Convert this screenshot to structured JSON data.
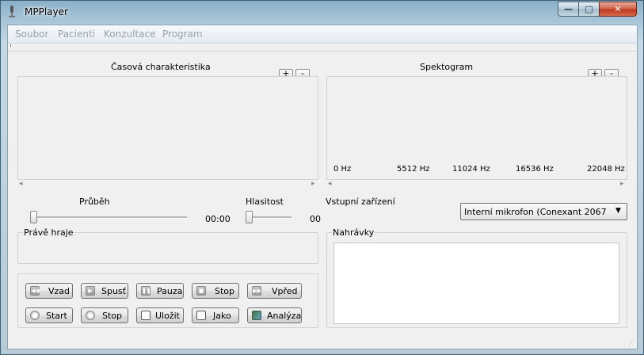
{
  "window": {
    "title": "MPPlayer",
    "minimize_glyph": "—",
    "maximize_glyph": "□",
    "close_glyph": "✕"
  },
  "menu": {
    "items": [
      "Soubor",
      "Pacienti",
      "Konzultace",
      "Program"
    ]
  },
  "time_panel": {
    "title": "Časová charakteristika",
    "zoom_in": "+",
    "zoom_out": "-"
  },
  "spectrogram": {
    "title": "Spektogram",
    "zoom_in": "+",
    "zoom_out": "-",
    "freq_labels": [
      "0 Hz",
      "5512 Hz",
      "11024 Hz",
      "16536 Hz",
      "22048 Hz"
    ]
  },
  "scroll": {
    "left_arrow": "◂",
    "right_arrow": "▸"
  },
  "progress": {
    "label": "Průběh",
    "time": "00:00",
    "position": 0
  },
  "volume": {
    "label": "Hlasitost",
    "value_text": "00",
    "level": 0
  },
  "input_device": {
    "label": "Vstupní zařízení",
    "selected": "Interní mikrofon (Conexant 2067",
    "dropdown_glyph": "▼"
  },
  "now_playing": {
    "label": "Právě hraje",
    "text": ""
  },
  "recordings": {
    "label": "Nahrávky",
    "items": []
  },
  "controls": {
    "back": "Vzad",
    "play": "Spusť",
    "pause": "Pauza",
    "stop_playback": "Stop",
    "forward": "Vpřed",
    "start_recording": "Start",
    "stop_recording": "Stop",
    "save": "Uložit",
    "save_as": "Jako",
    "analyze": "Analýza"
  },
  "icons": {
    "back": "rewind-icon",
    "play": "play-icon",
    "pause": "pause-icon",
    "stop_playback": "stop-icon",
    "forward": "fast-forward-icon",
    "start_recording": "record-icon",
    "stop_recording": "record-stop-icon",
    "save": "save-icon",
    "save_as": "save-as-icon",
    "analyze": "analyze-icon"
  },
  "colors": {
    "window_bg": "#f0f0f0",
    "close_button": "#c0391f",
    "menu_disabled_text": "#9aa2aa"
  }
}
